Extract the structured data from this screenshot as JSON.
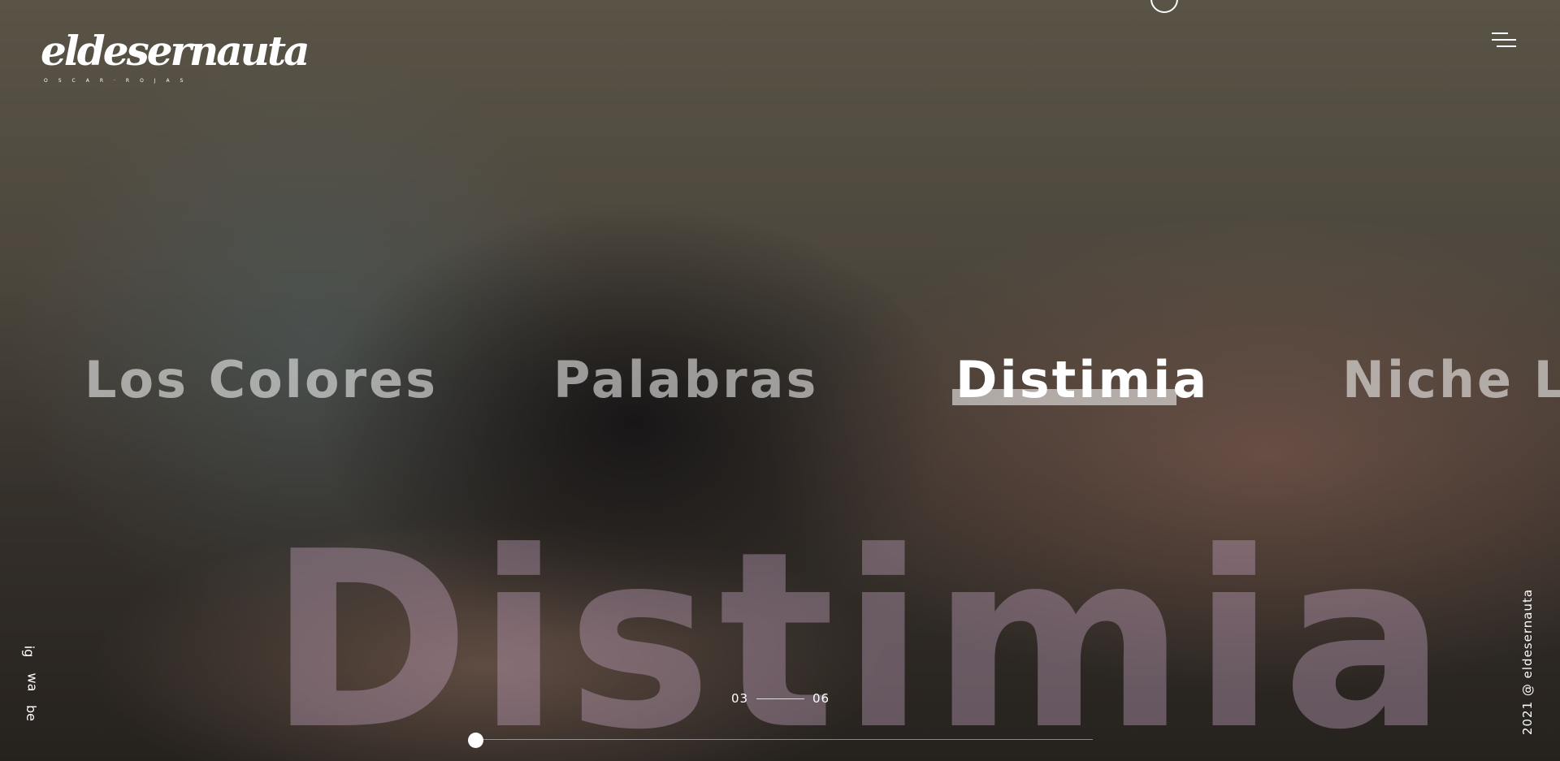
{
  "brand": {
    "logo_text": "eldesernauta",
    "logo_subtitle": "OSCAR·ROJAS"
  },
  "header": {
    "menu_icon": "hamburger-menu-icon"
  },
  "carousel": {
    "slides": [
      {
        "title": "Los Colores"
      },
      {
        "title": "Palabras"
      },
      {
        "title": "Distimia"
      },
      {
        "title": "Niche LS"
      }
    ],
    "active_index": 2,
    "active_title_watermark": "Distimia",
    "current": "03",
    "total": "06",
    "progress_fraction": 0.0
  },
  "social": {
    "ig": "ig",
    "wa": "wa",
    "be": "be"
  },
  "footer": {
    "copyright": "2021 @ eldesernauta"
  },
  "colors": {
    "text": "#ffffff",
    "watermark": "#bea0b9"
  }
}
